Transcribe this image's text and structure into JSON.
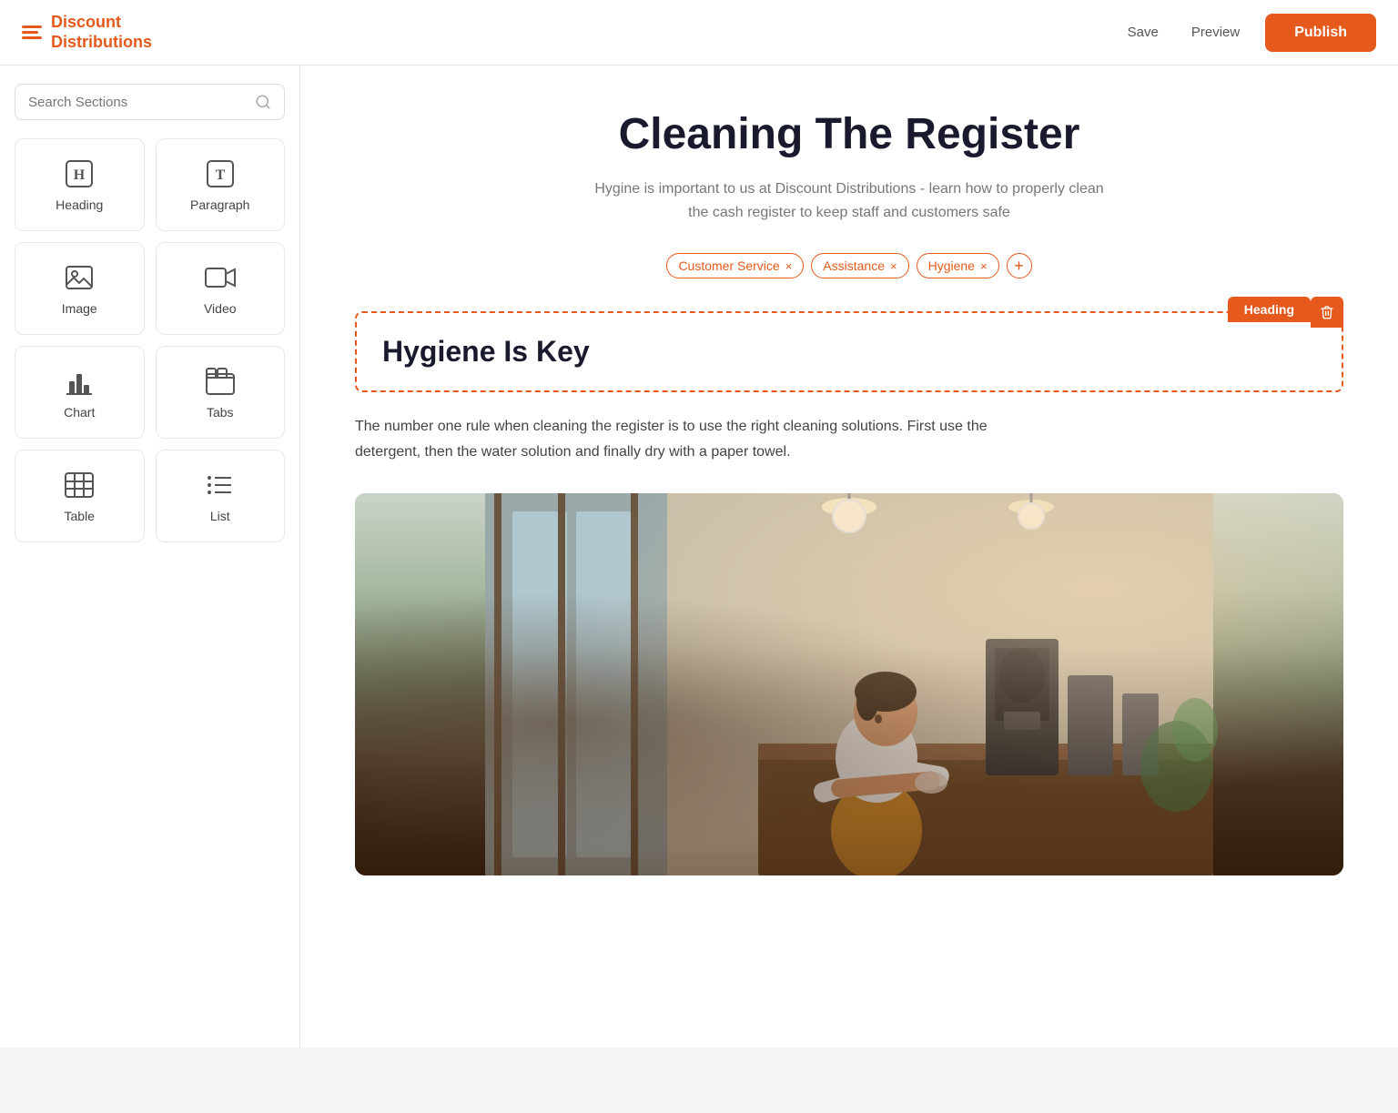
{
  "brand": {
    "name_line1": "Discount",
    "name_line2": "Distributions"
  },
  "header": {
    "save_label": "Save",
    "preview_label": "Preview",
    "publish_label": "Publish"
  },
  "sidebar": {
    "search_placeholder": "Search Sections",
    "sections": [
      {
        "id": "heading",
        "label": "Heading",
        "icon": "heading-icon"
      },
      {
        "id": "paragraph",
        "label": "Paragraph",
        "icon": "paragraph-icon"
      },
      {
        "id": "image",
        "label": "Image",
        "icon": "image-icon"
      },
      {
        "id": "video",
        "label": "Video",
        "icon": "video-icon"
      },
      {
        "id": "chart",
        "label": "Chart",
        "icon": "chart-icon"
      },
      {
        "id": "tabs",
        "label": "Tabs",
        "icon": "tabs-icon"
      },
      {
        "id": "table",
        "label": "Table",
        "icon": "table-icon"
      },
      {
        "id": "list",
        "label": "List",
        "icon": "list-icon"
      }
    ]
  },
  "page": {
    "title": "Cleaning The Register",
    "subtitle": "Hygine is important to us at Discount Distributions - learn how to properly clean the cash register to keep staff and customers safe",
    "tags": [
      {
        "label": "Customer Service"
      },
      {
        "label": "Assistance"
      },
      {
        "label": "Hygiene"
      }
    ],
    "tag_add_label": "+",
    "active_block": {
      "type_label": "Heading",
      "heading": "Hygiene Is Key"
    },
    "body_text": "The number one rule when cleaning the register is to use the right cleaning solutions. First use the detergent, then the water solution and finally dry with a paper towel."
  }
}
